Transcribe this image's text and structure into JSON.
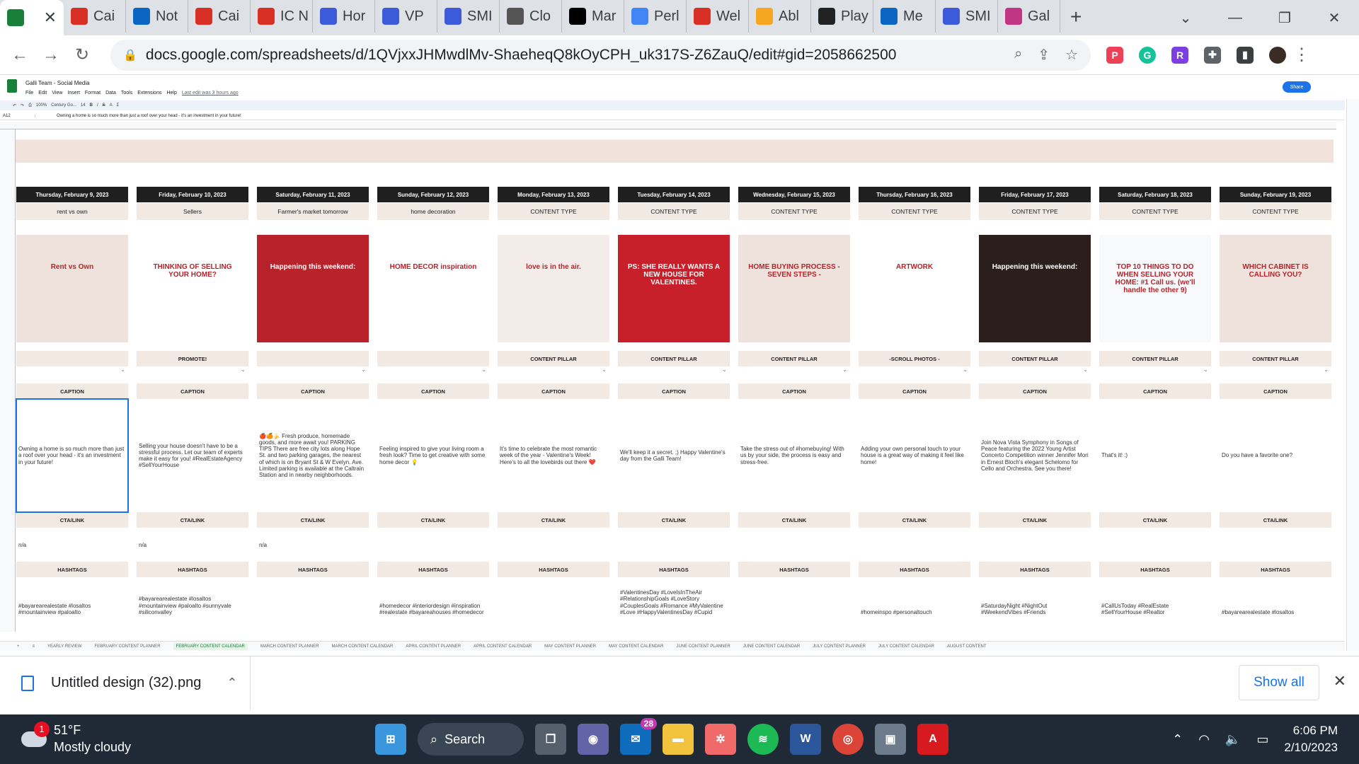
{
  "browser": {
    "tabs": [
      {
        "title": "",
        "icon": "sheets-icon",
        "color": "#188038",
        "active": true
      },
      {
        "title": "Cai",
        "icon": "gmail-icon",
        "color": "#d93025"
      },
      {
        "title": "Not",
        "icon": "linkedin-icon",
        "color": "#0a66c2"
      },
      {
        "title": "Cai",
        "icon": "gmail-icon",
        "color": "#d93025"
      },
      {
        "title": "IC N",
        "icon": "gmail-icon",
        "color": "#d93025"
      },
      {
        "title": "Hor",
        "icon": "c-icon",
        "color": "#3b5bdb"
      },
      {
        "title": "VP",
        "icon": "c-icon",
        "color": "#3b5bdb"
      },
      {
        "title": "SMI",
        "icon": "c-icon",
        "color": "#3b5bdb"
      },
      {
        "title": "Clo",
        "icon": "c-icon",
        "color": "#555555"
      },
      {
        "title": "Mar",
        "icon": "wix-icon",
        "color": "#000000"
      },
      {
        "title": "Perl",
        "icon": "doc-icon",
        "color": "#4285f4"
      },
      {
        "title": "Wel",
        "icon": "gmail-icon",
        "color": "#d93025"
      },
      {
        "title": "Abl",
        "icon": "diamond-icon",
        "color": "#f5a623"
      },
      {
        "title": "Play",
        "icon": "openai-icon",
        "color": "#222222"
      },
      {
        "title": "Me",
        "icon": "linkedin-icon",
        "color": "#0a66c2"
      },
      {
        "title": "SMI",
        "icon": "c-icon",
        "color": "#3b5bdb"
      },
      {
        "title": "Gal",
        "icon": "instagram-icon",
        "color": "#c13584"
      }
    ],
    "new_tab": "+",
    "url": "docs.google.com/spreadsheets/d/1QVjxxJHMwdlMv-ShaeheqQ8kOyCPH_uk317S-Z6ZauQ/edit#gid=2058662500"
  },
  "sheets": {
    "title": "Galli Team - Social Media",
    "menu": [
      "File",
      "Edit",
      "View",
      "Insert",
      "Format",
      "Data",
      "Tools",
      "Extensions",
      "Help"
    ],
    "last_edit": "Last edit was 3 hours ago",
    "share_label": "Share",
    "cell_ref": "A12",
    "formula": "Owning a home is so much more than just a roof over your head - it's an investment in your future!",
    "font_name": "Century Go...",
    "font_size": "14",
    "zoom": "100%"
  },
  "labels": {
    "content_pillar": "CONTENT PILLAR",
    "caption": "CAPTION",
    "cta": "CTA/LINK",
    "hashtags": "HASHTAGS"
  },
  "days": [
    {
      "date": "Thursday, February 9, 2023",
      "topic": "rent vs own",
      "pillar": "",
      "image_text": "Rent vs Own",
      "image_bg": "#efe2dc",
      "caption": "Owning a home is so much more than just a roof over your head - it's an investment in your future!",
      "cta": "n/a",
      "hashtags": "#bayarearealestate #losaltos #mountainview #paloalto"
    },
    {
      "date": "Friday, February 10, 2023",
      "topic": "Sellers",
      "pillar": "PROMOTE!",
      "image_text": "THINKING OF SELLING YOUR HOME?",
      "image_bg": "#ffffff",
      "caption": "Selling your house doesn't have to be a stressful process. Let our team of experts make it easy for you! #RealEstateAgency #SellYourHouse",
      "cta": "n/a",
      "hashtags": "#bayarearealestate #losaltos #mountainview #paloalto #sunnyvale #siliconvalley"
    },
    {
      "date": "Saturday, February 11, 2023",
      "topic": "Farmer's market tomorrow",
      "pillar": "",
      "image_text": "Happening this weekend:",
      "image_bg": "#b8232b",
      "caption": "🍎🍊🍌 Fresh produce, homemade goods, and more await you! PARKING TIPS There are free city lots along Hope St. and two parking garages, the nearest of which is on Bryant St & W Evelyn. Ave. Limited parking is available at the Caltrain Station and in nearby neighborhoods.",
      "cta": "n/a",
      "hashtags": ""
    },
    {
      "date": "Sunday, February 12, 2023",
      "topic": "home decoration",
      "pillar": "",
      "image_text": "HOME DECOR inspiration",
      "image_bg": "#ffffff",
      "caption": "Feeling inspired to give your living room a fresh look? Time to get creative with some home decor 💡",
      "cta": "",
      "hashtags": "#homedecor #interiordesign #inspiration #realestate #bayareahouses #homedecor"
    },
    {
      "date": "Monday, February 13, 2023",
      "topic": "CONTENT TYPE",
      "pillar": "CONTENT PILLAR",
      "image_text": "love is in the air.",
      "image_bg": "#f4ece9",
      "caption": "It's time to celebrate the most romantic week of the year - Valentine's Week! Here's to all the lovebirds out there ❤️",
      "cta": "",
      "hashtags": ""
    },
    {
      "date": "Tuesday, February 14, 2023",
      "topic": "CONTENT TYPE",
      "pillar": "CONTENT PILLAR",
      "image_text": "PS: SHE REALLY WANTS A NEW HOUSE FOR VALENTINES.",
      "image_bg": "#c8202a",
      "caption": "We'll keep it a secret. ;) Happy Valentine's day from the Galli Team!",
      "cta": "",
      "hashtags": "#ValentinesDay #LoveIsInTheAir #RelationshipGoals #LoveStory #CouplesGoals #Romance #MyValentine #Love #HappyValentinesDay #Cupid"
    },
    {
      "date": "Wednesday, February 15, 2023",
      "topic": "CONTENT TYPE",
      "pillar": "CONTENT PILLAR",
      "image_text": "HOME BUYING PROCESS - SEVEN STEPS -",
      "image_bg": "#efe2dc",
      "caption": "Take the stress out of #homebuying! With us by your side, the process is easy and stress-free.",
      "cta": "",
      "hashtags": ""
    },
    {
      "date": "Thursday, February 16, 2023",
      "topic": "CONTENT TYPE",
      "pillar": "-SCROLL PHOTOS -",
      "image_text": "ARTWORK",
      "image_bg": "#ffffff",
      "caption": "Adding your own personal touch to your house is a great way of making it feel like home!",
      "cta": "",
      "hashtags": "#homeinspo #personaltouch"
    },
    {
      "date": "Friday, February 17, 2023",
      "topic": "CONTENT TYPE",
      "pillar": "CONTENT PILLAR",
      "image_text": "Happening this weekend:",
      "image_bg": "#2a1f1a",
      "caption": "Join Nova Vista Symphony in Songs of Peace featuring the 2022 Young Artist Concerto Competition winner Jennifer Mori in Ernest Bloch's elegant Schelomo for Cello and Orchestra. See you there!",
      "cta": "",
      "hashtags": "#SaturdayNight #NightOut #WeekendVibes #Friends"
    },
    {
      "date": "Saturday, February 18, 2023",
      "topic": "CONTENT TYPE",
      "pillar": "CONTENT PILLAR",
      "image_text": "TOP 10 THINGS TO DO WHEN SELLING YOUR HOME: #1 Call us. (we'll handle the other 9)",
      "image_bg": "#f7f9fb",
      "caption": "That's it! :)",
      "cta": "",
      "hashtags": "#CallUsToday #RealEstate #SellYourHouse #Realtor"
    },
    {
      "date": "Sunday, February 19, 2023",
      "topic": "CONTENT TYPE",
      "pillar": "CONTENT PILLAR",
      "image_text": "WHICH CABINET IS CALLING YOU?",
      "image_bg": "#efe2dc",
      "caption": "Do you have a favorite one?",
      "cta": "",
      "hashtags": "#bayarearealestate #losaltos"
    }
  ],
  "sheet_tabs": [
    "YEARLY REVIEW",
    "FEBRUARY CONTENT PLANNER",
    "FEBRUARY CONTENT CALENDAR",
    "MARCH CONTENT PLANNER",
    "MARCH CONTENT CALENDAR",
    "APRIL CONTENT PLANNER",
    "APRIL CONTENT CALENDAR",
    "MAY CONTENT PLANNER",
    "MAY CONTENT CALENDAR",
    "JUNE CONTENT PLANNER",
    "JUNE CONTENT CALENDAR",
    "JULY CONTENT PLANNER",
    "JULY CONTENT CALENDAR",
    "AUGUST CONTENT"
  ],
  "active_sheet_tab": "FEBRUARY CONTENT CALENDAR",
  "downloads": {
    "file": "Untitled design (32).png",
    "show_all": "Show all"
  },
  "taskbar": {
    "temp": "51°F",
    "weather": "Mostly cloudy",
    "weather_badge": "1",
    "search": "Search",
    "mail_badge": "28",
    "time": "6:06 PM",
    "date": "2/10/2023"
  }
}
